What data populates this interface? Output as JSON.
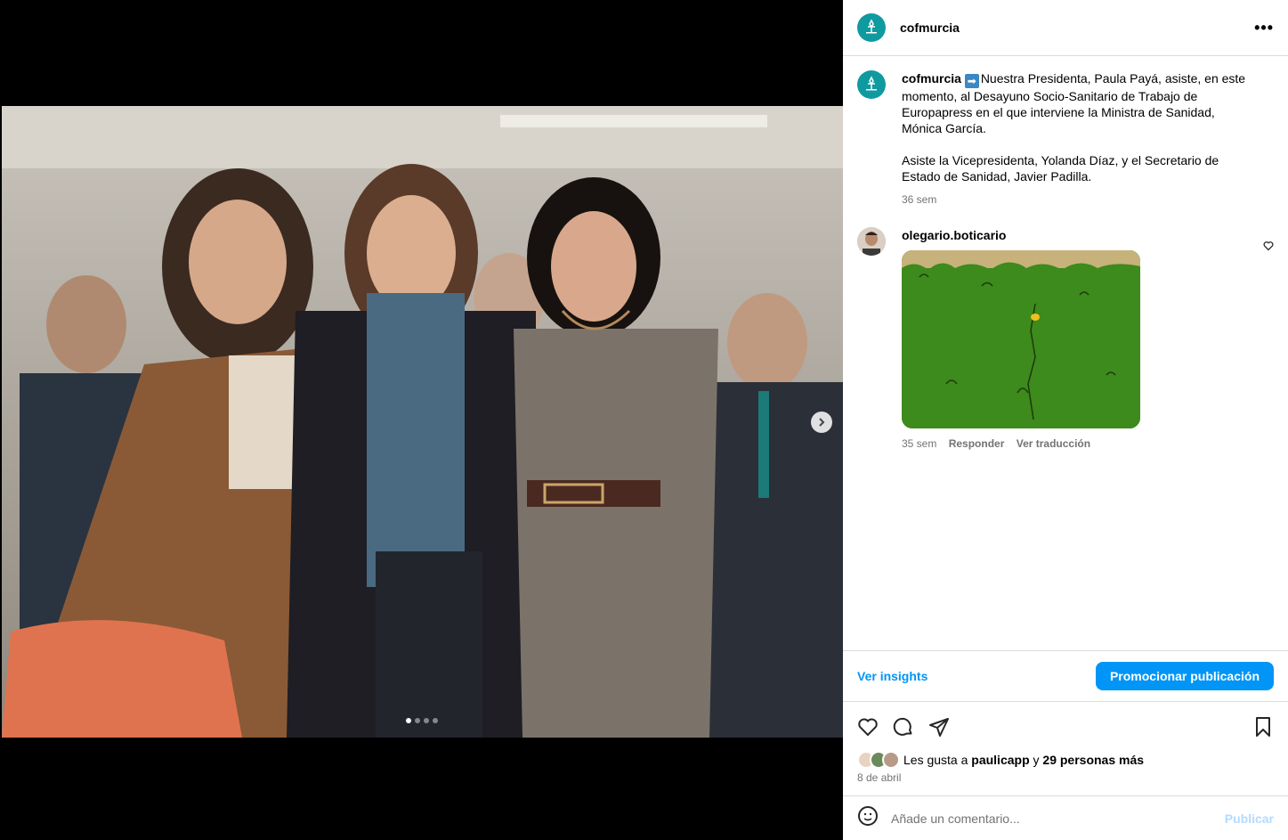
{
  "header": {
    "username": "cofmurcia",
    "more_label": "•••"
  },
  "caption": {
    "username": "cofmurcia",
    "emoji": "➡",
    "text1": "Nuestra Presidenta, Paula Payá, asiste, en este momento, al Desayuno Socio-Sanitario de Trabajo de Europapress en el que interviene la Ministra de Sanidad, Mónica García.",
    "text2": "Asiste la Vicepresidenta, Yolanda Díaz, y el Secretario de Estado de Sanidad, Javier Padilla.",
    "time": "36 sem"
  },
  "reply": {
    "username": "olegario.boticario",
    "time": "35 sem",
    "reply_label": "Responder",
    "translate_label": "Ver traducción"
  },
  "actions": {
    "insights_label": "Ver insights",
    "promote_label": "Promocionar publicación"
  },
  "likes": {
    "prefix": "Les gusta a",
    "user": "paulicapp",
    "connector": "y",
    "others": "29 personas más"
  },
  "date": "8 de abril",
  "comment_box": {
    "placeholder": "Añade un comentario...",
    "publish_label": "Publicar"
  },
  "carousel": {
    "slides": 4,
    "active": 1
  },
  "colors": {
    "accent": "#0095f6",
    "brand": "#0f9aa0",
    "gif_green": "#3d8a1d"
  }
}
